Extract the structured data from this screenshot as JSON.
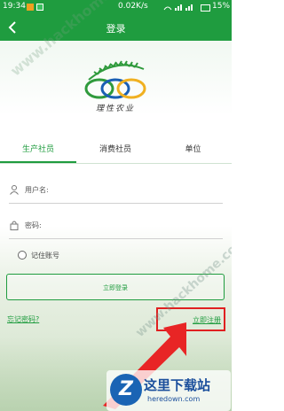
{
  "status_bar": {
    "time": "19:34",
    "network": "0.02K/s",
    "battery": "15%"
  },
  "header": {
    "title": "登录"
  },
  "logo": {
    "text": "理性农业"
  },
  "watermarks": {
    "top": "www.hackhome.com",
    "bottom": "www.hackhome.com"
  },
  "tabs": [
    {
      "label": "生产社员",
      "active": true
    },
    {
      "label": "消费社员",
      "active": false
    },
    {
      "label": "单位",
      "active": false
    }
  ],
  "form": {
    "username_label": "用户名:",
    "username_value": "",
    "password_label": "密码:",
    "password_value": "",
    "remember_label": "记住账号",
    "login_label": "立即登录",
    "forgot_label": "忘记密码?",
    "register_label": "立即注册"
  },
  "site_badge": {
    "cn": "这里下载站",
    "en": "heredown.com"
  },
  "colors": {
    "primary": "#1f9c3f",
    "highlight": "#e02020",
    "arrow": "#e82525"
  },
  "icons": [
    "back-icon",
    "user-icon",
    "lock-icon",
    "radio-icon",
    "arrow-icon"
  ]
}
